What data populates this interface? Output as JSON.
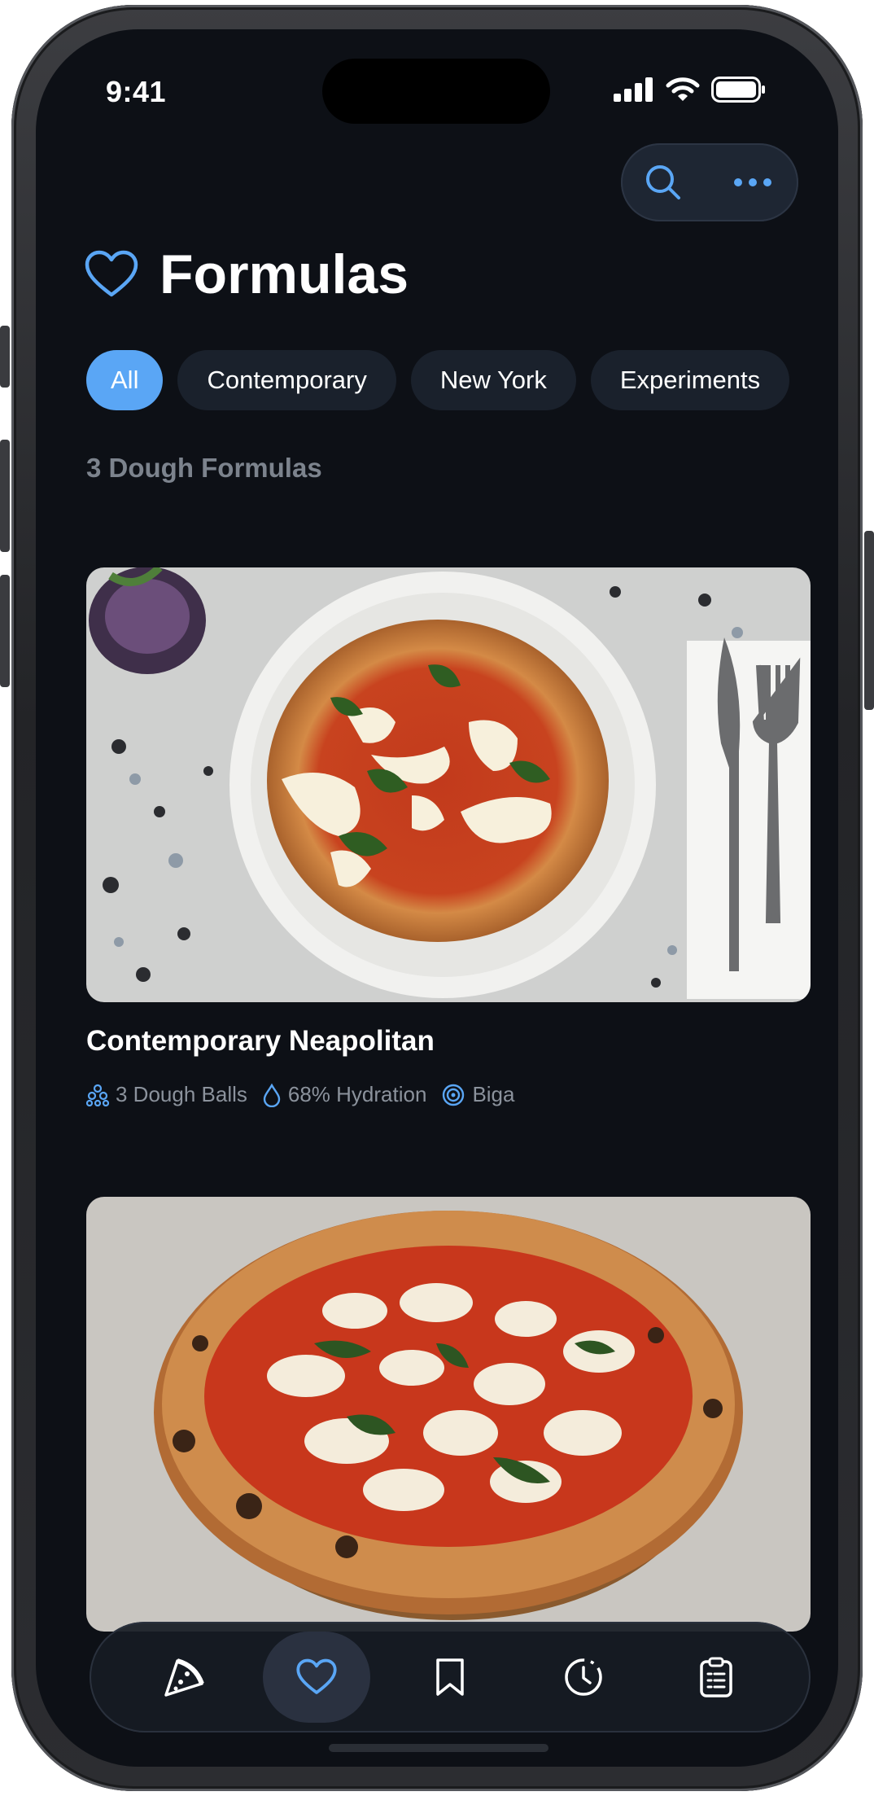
{
  "status_bar": {
    "time": "9:41"
  },
  "top_actions": {
    "search_icon": "search-icon",
    "more_icon": "more-icon"
  },
  "header": {
    "icon": "heart-icon",
    "title": "Formulas"
  },
  "filters": [
    {
      "label": "All",
      "active": true
    },
    {
      "label": "Contemporary",
      "active": false
    },
    {
      "label": "New York",
      "active": false
    },
    {
      "label": "Experiments",
      "active": false
    }
  ],
  "formula_count": "3 Dough Formulas",
  "cards": [
    {
      "name": "Contemporary Neapolitan",
      "balls": "3 Dough Balls",
      "hydration": "68% Hydration",
      "preferment": "Biga"
    },
    {
      "name": "",
      "balls": "",
      "hydration": "",
      "preferment": ""
    }
  ],
  "tabs": [
    {
      "icon": "pizza-slice-icon",
      "active": false
    },
    {
      "icon": "heart-icon",
      "active": true
    },
    {
      "icon": "bookmark-icon",
      "active": false
    },
    {
      "icon": "history-icon",
      "active": false
    },
    {
      "icon": "clipboard-icon",
      "active": false
    }
  ],
  "colors": {
    "background": "#0d1016",
    "accent": "#5aa6f5",
    "chip": "#1a212c",
    "muted_text": "#7c838d"
  }
}
